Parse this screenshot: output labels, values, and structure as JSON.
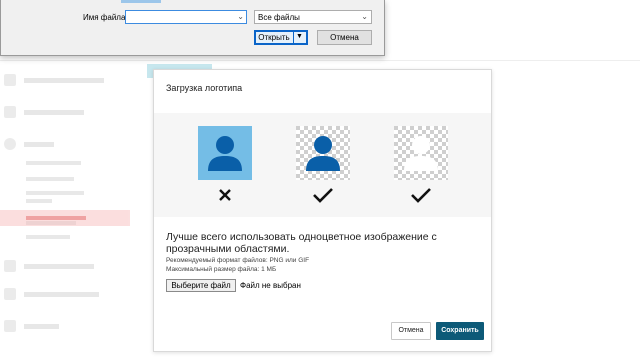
{
  "file_dialog": {
    "filename_label": "Имя файла:",
    "filename_value": "",
    "filetype_value": "Все файлы",
    "open_label": "Открыть",
    "cancel_label": "Отмена"
  },
  "modal": {
    "title": "Загрузка логотипа",
    "description": "Лучше всего использовать одноцветное изображение с прозрачными областями.",
    "hint_format": "Рекомендуемый формат файлов: PNG или GIF",
    "hint_size": "Максимальный размер файла: 1 МБ",
    "choose_file_label": "Выберите файл",
    "no_file_label": "Файл не выбран",
    "cancel_label": "Отмена",
    "save_label": "Сохранить",
    "examples": [
      {
        "icon": "person-icon",
        "background": "light-blue",
        "figure_color": "#0a5fa8",
        "verdict": "cross-icon"
      },
      {
        "icon": "person-icon",
        "background": "transparent-checker",
        "figure_color": "#0a5fa8",
        "verdict": "check-icon"
      },
      {
        "icon": "person-icon",
        "background": "transparent-checker",
        "figure_color": "#ffffff",
        "verdict": "check-icon"
      }
    ]
  },
  "colors": {
    "accent": "#0d5a78",
    "light_blue": "#74bde6",
    "dialog_focus": "#0a64c8"
  }
}
